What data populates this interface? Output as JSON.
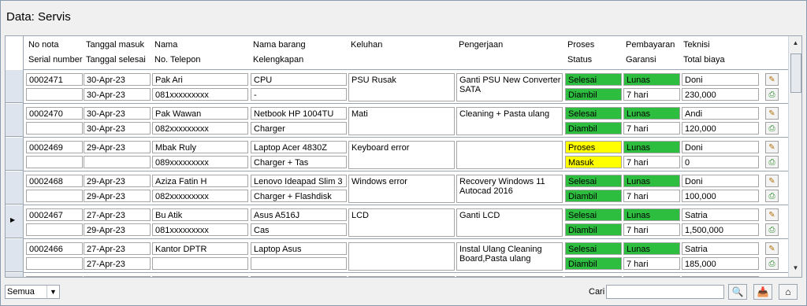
{
  "window": {
    "title": "Data: Servis"
  },
  "headers": {
    "no_nota": "No nota",
    "serial": "Serial number",
    "tgl_masuk": "Tanggal masuk",
    "tgl_selesai": "Tanggal selesai",
    "nama": "Nama",
    "telepon": "No. Telepon",
    "barang": "Nama barang",
    "kelengkapan": "Kelengkapan",
    "keluhan": "Keluhan",
    "pengerjaan": "Pengerjaan",
    "proses": "Proses",
    "status": "Status",
    "pembayaran": "Pembayaran",
    "garansi": "Garansi",
    "teknisi": "Teknisi",
    "total": "Total biaya"
  },
  "colors": {
    "green": "#2dbd3f",
    "yellow": "#ffff00"
  },
  "rows": [
    {
      "nota": "0002471",
      "serial": "",
      "tgl_masuk": "30-Apr-23",
      "tgl_selesai": "30-Apr-23",
      "nama": "Pak Ari",
      "telepon": "081xxxxxxxxx",
      "barang": "CPU",
      "kelengkapan": "-",
      "keluhan": "PSU Rusak",
      "pengerjaan": "Ganti PSU New Converter SATA",
      "proses": "Selesai",
      "status": "Diambil",
      "pembayaran": "Lunas",
      "garansi": "7 hari",
      "teknisi": "Doni",
      "total": "230,000"
    },
    {
      "nota": "0002470",
      "serial": "",
      "tgl_masuk": "30-Apr-23",
      "tgl_selesai": "30-Apr-23",
      "nama": "Pak Wawan",
      "telepon": "082xxxxxxxxx",
      "barang": "Netbook HP 1004TU",
      "kelengkapan": "Charger",
      "keluhan": "Mati",
      "pengerjaan": "Cleaning + Pasta ulang",
      "proses": "Selesai",
      "status": "Diambil",
      "pembayaran": "Lunas",
      "garansi": "7 hari",
      "teknisi": "Andi",
      "total": "120,000"
    },
    {
      "nota": "0002469",
      "serial": "",
      "tgl_masuk": "29-Apr-23",
      "tgl_selesai": "",
      "nama": "Mbak Ruly",
      "telepon": "089xxxxxxxxx",
      "barang": "Laptop Acer 4830Z",
      "kelengkapan": "Charger + Tas",
      "keluhan": "Keyboard error",
      "pengerjaan": "",
      "proses": "Proses",
      "status": "Masuk",
      "pembayaran": "Lunas",
      "garansi": "7 hari",
      "teknisi": "Doni",
      "total": "0"
    },
    {
      "nota": "0002468",
      "serial": "",
      "tgl_masuk": "29-Apr-23",
      "tgl_selesai": "29-Apr-23",
      "nama": "Aziza Fatin H",
      "telepon": "082xxxxxxxxx",
      "barang": "Lenovo Ideapad Slim 3",
      "kelengkapan": "Charger + Flashdisk",
      "keluhan": "Windows error",
      "pengerjaan": "Recovery Windows 11 Autocad 2016",
      "proses": "Selesai",
      "status": "Diambil",
      "pembayaran": "Lunas",
      "garansi": "7 hari",
      "teknisi": "Doni",
      "total": "100,000"
    },
    {
      "nota": "0002467",
      "serial": "",
      "tgl_masuk": "27-Apr-23",
      "tgl_selesai": "29-Apr-23",
      "nama": "Bu Atik",
      "telepon": "081xxxxxxxxx",
      "barang": "Asus A516J",
      "kelengkapan": "Cas",
      "keluhan": "LCD",
      "pengerjaan": "Ganti LCD",
      "proses": "Selesai",
      "status": "Diambil",
      "pembayaran": "Lunas",
      "garansi": "7 hari",
      "teknisi": "Satria",
      "total": "1,500,000"
    },
    {
      "nota": "0002466",
      "serial": "",
      "tgl_masuk": "27-Apr-23",
      "tgl_selesai": "27-Apr-23",
      "nama": "Kantor DPTR",
      "telepon": "",
      "barang": "Laptop Asus",
      "kelengkapan": "",
      "keluhan": "",
      "pengerjaan": "Instal Ulang Cleaning Board,Pasta ulang",
      "proses": "Selesai",
      "status": "Diambil",
      "pembayaran": "Lunas",
      "garansi": "7 hari",
      "teknisi": "Satria",
      "total": "185,000"
    }
  ],
  "footer": {
    "filter_value": "Semua",
    "search_label": "Cari",
    "search_value": ""
  }
}
